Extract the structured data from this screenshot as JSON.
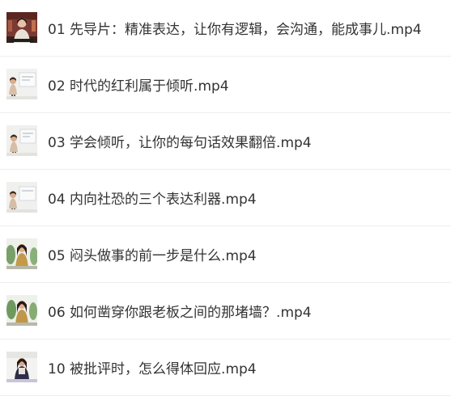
{
  "files": [
    {
      "name": "01 先导片：精准表达，让你有逻辑，会沟通，能成事儿.mp4",
      "thumb_icon": "video-thumbnail-speaker-red-bookshelf-icon"
    },
    {
      "name": "02 时代的红利属于倾听.mp4",
      "thumb_icon": "video-thumbnail-lecture-screen-icon"
    },
    {
      "name": "03 学会倾听，让你的每句话效果翻倍.mp4",
      "thumb_icon": "video-thumbnail-lecture-screen-icon"
    },
    {
      "name": "04 内向社恐的三个表达利器.mp4",
      "thumb_icon": "video-thumbnail-lecture-screen-icon"
    },
    {
      "name": "05 闷头做事的前一步是什么.mp4",
      "thumb_icon": "video-thumbnail-speaker-plants-icon"
    },
    {
      "name": "06 如何凿穿你跟老板之间的那堵墙？.mp4",
      "thumb_icon": "video-thumbnail-speaker-plants-icon"
    },
    {
      "name": "10 被批评时，怎么得体回应.mp4",
      "thumb_icon": "video-thumbnail-speaker-stage-icon"
    }
  ]
}
